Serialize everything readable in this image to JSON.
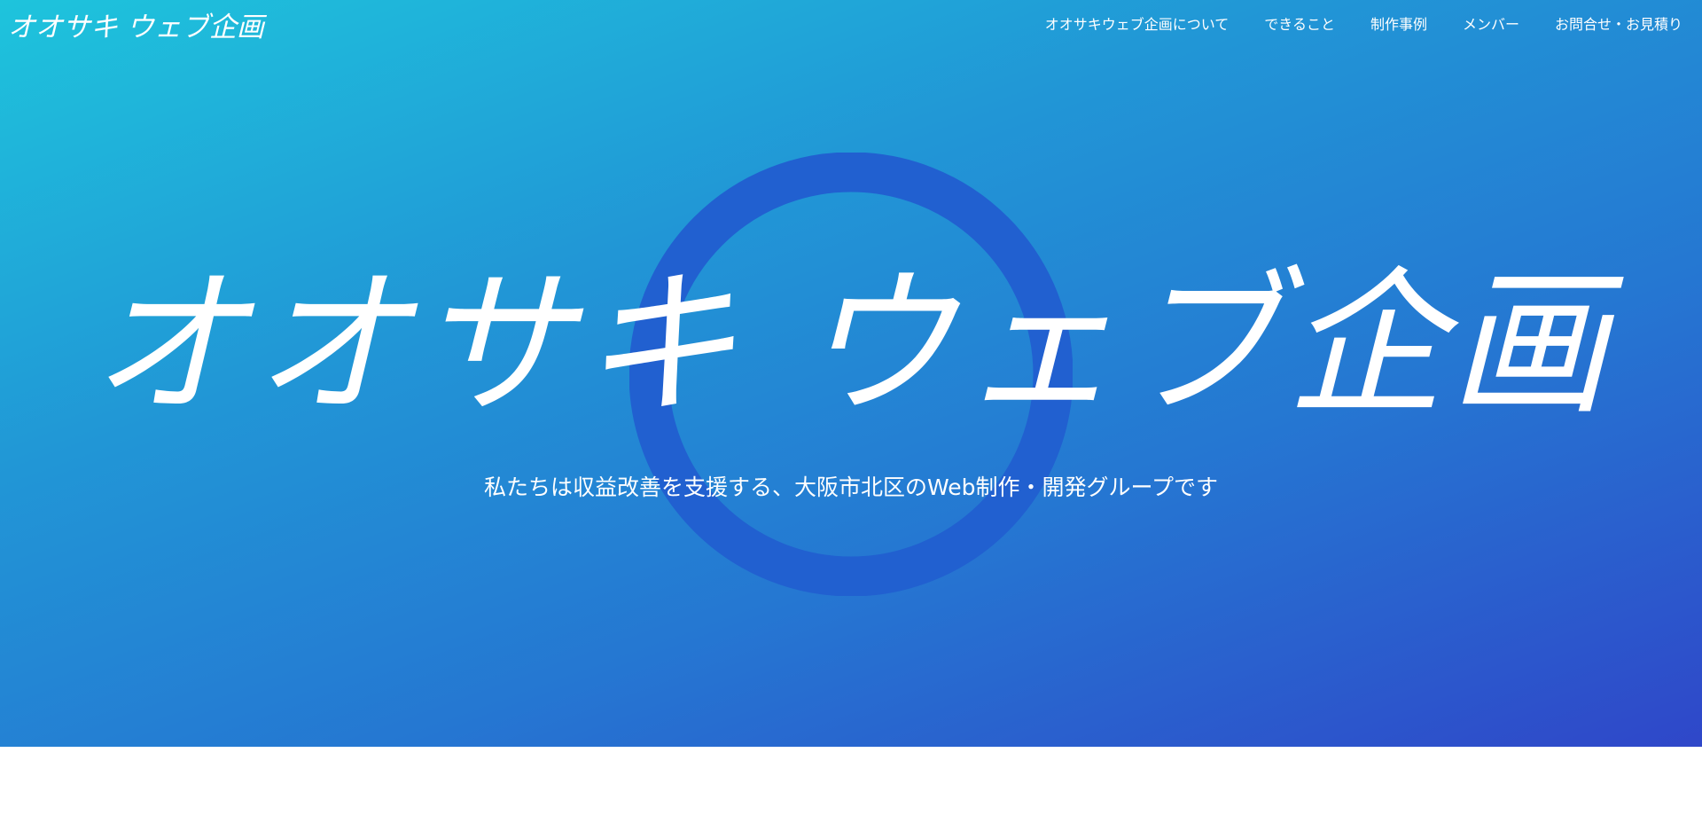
{
  "header": {
    "logo": "オオサキ ウェブ企画",
    "nav": [
      {
        "label": "オオサキウェブ企画について"
      },
      {
        "label": "できること"
      },
      {
        "label": "制作事例"
      },
      {
        "label": "メンバー"
      },
      {
        "label": "お問合せ・お見積り"
      }
    ]
  },
  "hero": {
    "title": "オオサキ ウェブ企画",
    "subtitle": "私たちは収益改善を支援する、大阪市北区のWeb制作・開発グループです"
  },
  "colors": {
    "gradient_start": "#1ec4dc",
    "gradient_end": "#2f47c9",
    "ring": "#2160d0",
    "text": "#ffffff"
  }
}
